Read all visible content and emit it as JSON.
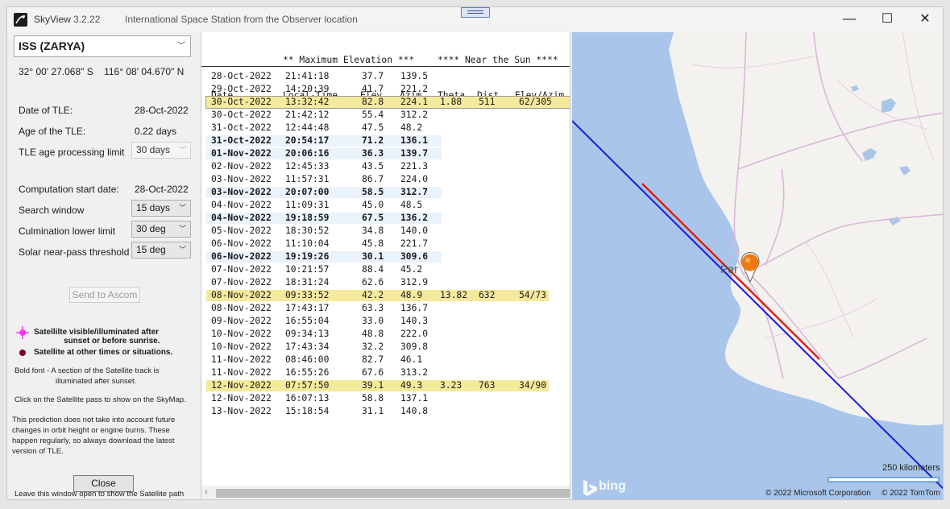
{
  "window": {
    "app_name": "SkyView",
    "version": "3.2.22",
    "title": "International Space Station from the Observer location",
    "minimize": "—",
    "maximize": "☐",
    "close": "✕"
  },
  "left_panel": {
    "satellite": "ISS (ZARYA)",
    "coordinates": "32° 00' 27.068\" S    116° 08' 04.670\" N",
    "date_of_tle_label": "Date of TLE:",
    "date_of_tle": "28-Oct-2022",
    "age_of_tle_label": "Age of the TLE:",
    "age_of_tle": "0.22 days",
    "tle_limit_label": "TLE age processing limit",
    "tle_limit": "30 days",
    "computation_start_label": "Computation start date:",
    "computation_start": "28-Oct-2022",
    "search_window_label": "Search window",
    "search_window": "15 days",
    "culmination_label": "Culmination lower limit",
    "culmination": "30 deg",
    "solar_threshold_label": "Solar near-pass threshold",
    "solar_threshold": "15 deg",
    "send_button": "Send to Ascom",
    "legend_visible_line1": "Satellilte visible/illuminated after",
    "legend_visible_line2": "sunset or before sunrise.",
    "legend_other": "Satellite at other times or situations.",
    "bold_note_line1": "Bold font - A section of the Satellite track is",
    "bold_note_line2": "illuminated after sunset.",
    "click_note": "Click on the Satellite pass to show on the SkyMap.",
    "prediction_note_line1": "This prediction does not take into account future",
    "prediction_note_line2": "changes in orbit height or engine burns. These",
    "prediction_note_line3": "happen regularly, so always download the latest",
    "prediction_note_line4": "version of TLE.",
    "close_button": "Close",
    "leave_note": "Leave this window open to show the Satellite path",
    "colors": {
      "visible": "#ff33ff",
      "other": "#7a003a"
    }
  },
  "table": {
    "group_max_elev": "** Maximum Elevation ***",
    "group_near_sun": "**** Near the Sun ****",
    "col_date": "Date",
    "col_local_time": "Local-Time",
    "col_elev": "Elev",
    "col_azim": "Azim",
    "col_theta": "Theta",
    "col_dist": "Dist",
    "col_elev_azim": "Elev/Azim",
    "rows": [
      {
        "date": "28-Oct-2022",
        "time": "21:41:18",
        "elev": "37.7",
        "azim": "139.5",
        "theta": "",
        "dist": "",
        "ea": "",
        "style": "normal"
      },
      {
        "date": "29-Oct-2022",
        "time": "14:20:39",
        "elev": "41.7",
        "azim": "221.2",
        "theta": "",
        "dist": "",
        "ea": "",
        "style": "normal"
      },
      {
        "date": "30-Oct-2022",
        "time": "13:32:42",
        "elev": "82.8",
        "azim": "224.1",
        "theta": "1.88",
        "dist": "511",
        "ea": "62/305",
        "style": "near",
        "selected": true
      },
      {
        "date": "30-Oct-2022",
        "time": "21:42:12",
        "elev": "55.4",
        "azim": "312.2",
        "theta": "",
        "dist": "",
        "ea": "",
        "style": "normal"
      },
      {
        "date": "31-Oct-2022",
        "time": "12:44:48",
        "elev": "47.5",
        "azim": "48.2",
        "theta": "",
        "dist": "",
        "ea": "",
        "style": "normal"
      },
      {
        "date": "31-Oct-2022",
        "time": "20:54:17",
        "elev": "71.2",
        "azim": "136.1",
        "theta": "",
        "dist": "",
        "ea": "",
        "style": "bold"
      },
      {
        "date": "01-Nov-2022",
        "time": "20:06:16",
        "elev": "36.3",
        "azim": "139.7",
        "theta": "",
        "dist": "",
        "ea": "",
        "style": "bold"
      },
      {
        "date": "02-Nov-2022",
        "time": "12:45:33",
        "elev": "43.5",
        "azim": "221.3",
        "theta": "",
        "dist": "",
        "ea": "",
        "style": "normal"
      },
      {
        "date": "03-Nov-2022",
        "time": "11:57:31",
        "elev": "86.7",
        "azim": "224.0",
        "theta": "",
        "dist": "",
        "ea": "",
        "style": "normal"
      },
      {
        "date": "03-Nov-2022",
        "time": "20:07:00",
        "elev": "58.5",
        "azim": "312.7",
        "theta": "",
        "dist": "",
        "ea": "",
        "style": "bold"
      },
      {
        "date": "04-Nov-2022",
        "time": "11:09:31",
        "elev": "45.0",
        "azim": "48.5",
        "theta": "",
        "dist": "",
        "ea": "",
        "style": "normal"
      },
      {
        "date": "04-Nov-2022",
        "time": "19:18:59",
        "elev": "67.5",
        "azim": "136.2",
        "theta": "",
        "dist": "",
        "ea": "",
        "style": "bold"
      },
      {
        "date": "05-Nov-2022",
        "time": "18:30:52",
        "elev": "34.8",
        "azim": "140.0",
        "theta": "",
        "dist": "",
        "ea": "",
        "style": "normal"
      },
      {
        "date": "06-Nov-2022",
        "time": "11:10:04",
        "elev": "45.8",
        "azim": "221.7",
        "theta": "",
        "dist": "",
        "ea": "",
        "style": "normal"
      },
      {
        "date": "06-Nov-2022",
        "time": "19:19:26",
        "elev": "30.1",
        "azim": "309.6",
        "theta": "",
        "dist": "",
        "ea": "",
        "style": "bold"
      },
      {
        "date": "07-Nov-2022",
        "time": "10:21:57",
        "elev": "88.4",
        "azim": "45.2",
        "theta": "",
        "dist": "",
        "ea": "",
        "style": "normal"
      },
      {
        "date": "07-Nov-2022",
        "time": "18:31:24",
        "elev": "62.6",
        "azim": "312.9",
        "theta": "",
        "dist": "",
        "ea": "",
        "style": "normal"
      },
      {
        "date": "08-Nov-2022",
        "time": "09:33:52",
        "elev": "42.2",
        "azim": "48.9",
        "theta": "13.82",
        "dist": "632",
        "ea": "54/73",
        "style": "near"
      },
      {
        "date": "08-Nov-2022",
        "time": "17:43:17",
        "elev": "63.3",
        "azim": "136.7",
        "theta": "",
        "dist": "",
        "ea": "",
        "style": "normal"
      },
      {
        "date": "09-Nov-2022",
        "time": "16:55:04",
        "elev": "33.0",
        "azim": "140.3",
        "theta": "",
        "dist": "",
        "ea": "",
        "style": "normal"
      },
      {
        "date": "10-Nov-2022",
        "time": "09:34:13",
        "elev": "48.8",
        "azim": "222.0",
        "theta": "",
        "dist": "",
        "ea": "",
        "style": "normal"
      },
      {
        "date": "10-Nov-2022",
        "time": "17:43:34",
        "elev": "32.2",
        "azim": "309.8",
        "theta": "",
        "dist": "",
        "ea": "",
        "style": "normal"
      },
      {
        "date": "11-Nov-2022",
        "time": "08:46:00",
        "elev": "82.7",
        "azim": "46.1",
        "theta": "",
        "dist": "",
        "ea": "",
        "style": "normal"
      },
      {
        "date": "11-Nov-2022",
        "time": "16:55:26",
        "elev": "67.6",
        "azim": "313.2",
        "theta": "",
        "dist": "",
        "ea": "",
        "style": "normal"
      },
      {
        "date": "12-Nov-2022",
        "time": "07:57:50",
        "elev": "39.1",
        "azim": "49.3",
        "theta": "3.23",
        "dist": "763",
        "ea": "34/90",
        "style": "near"
      },
      {
        "date": "12-Nov-2022",
        "time": "16:07:13",
        "elev": "58.8",
        "azim": "137.1",
        "theta": "",
        "dist": "",
        "ea": "",
        "style": "normal"
      },
      {
        "date": "13-Nov-2022",
        "time": "15:18:54",
        "elev": "31.1",
        "azim": "140.8",
        "theta": "",
        "dist": "",
        "ea": "",
        "style": "normal"
      }
    ]
  },
  "map": {
    "city_label": "Per",
    "scale_label": "250 kilometers",
    "copyright_ms": "© 2022 Microsoft Corporation",
    "copyright_tomtom": "© 2022 TomTom",
    "provider_logo": "bing",
    "colors": {
      "water": "#a9c6ea",
      "land": "#f4f2ee",
      "track_blue": "#1a1adb",
      "track_red": "#e01f1f",
      "marker": "#f07a10"
    }
  }
}
